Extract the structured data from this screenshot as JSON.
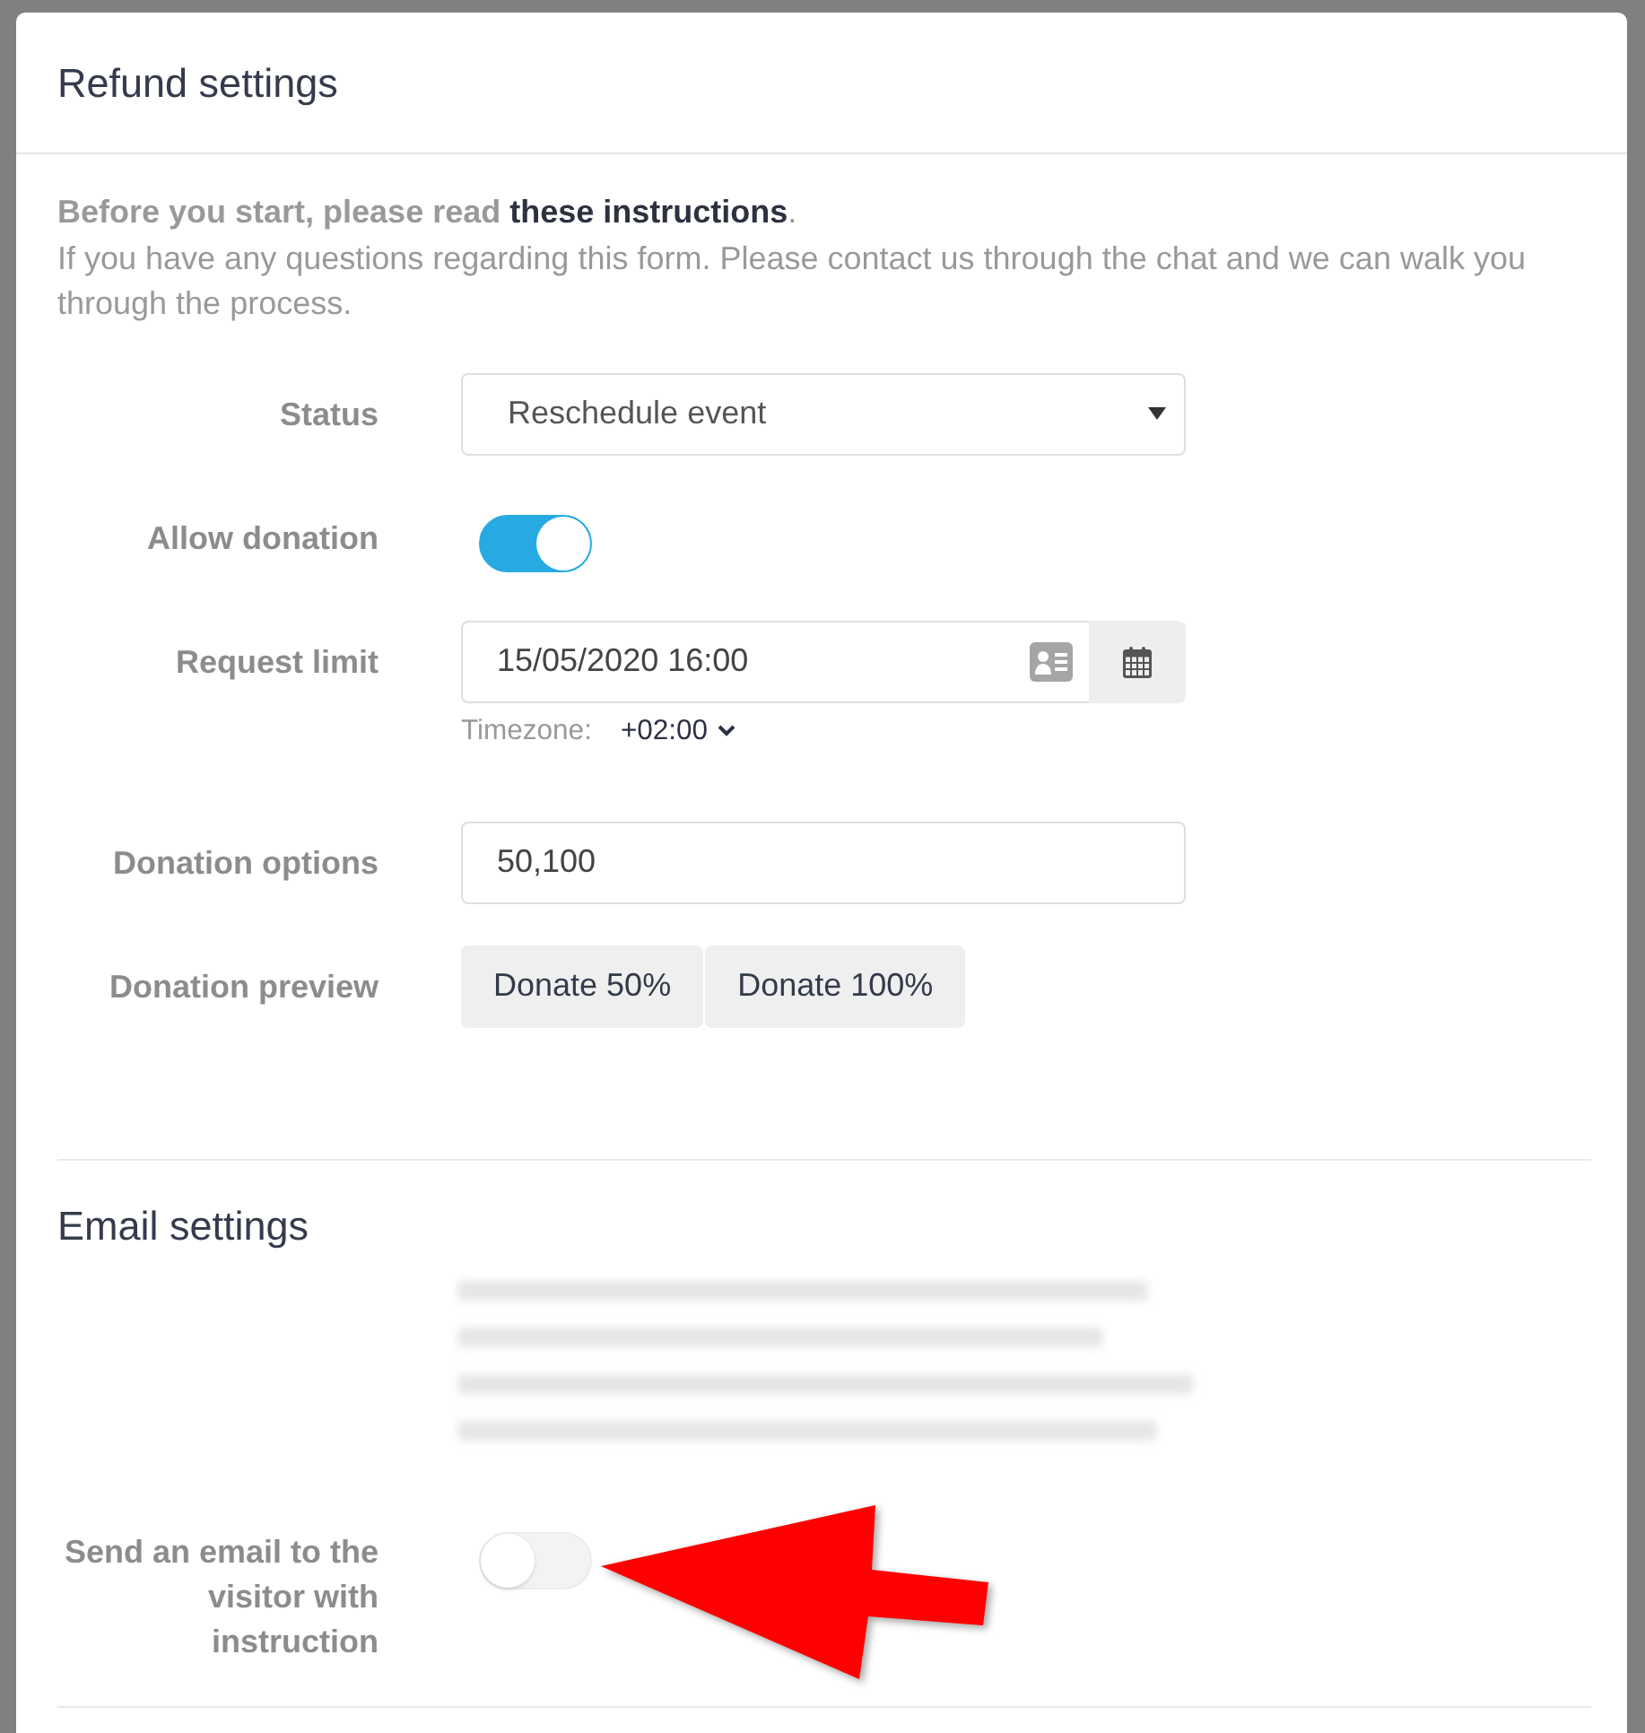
{
  "dialog": {
    "title": "Refund settings"
  },
  "intro": {
    "text": "Before you start, please read",
    "link": "these instructions",
    "end": "."
  },
  "help_text": "If you have any questions regarding this form. Please contact us through the chat and we can walk you through the process.",
  "fields": [
    {
      "kind": "select",
      "label": "Status",
      "value": "Reschedule event"
    },
    {
      "kind": "toggle",
      "label": "Allow donation",
      "on": true
    },
    {
      "kind": "datetime",
      "label": "Request limit",
      "value": "15/05/2020 16:00",
      "timezone_label": "Timezone:",
      "timezone": "+02:00"
    },
    {
      "kind": "text",
      "label": "Donation options",
      "value": "50,100"
    },
    {
      "kind": "buttons",
      "label": "Donation preview",
      "buttons": [
        "Donate 50%",
        "Donate 100%"
      ]
    }
  ],
  "email_settings": {
    "title": "Email settings",
    "fields": [
      {
        "kind": "toggle",
        "label": "Send an email to the visitor with instruction",
        "on": false
      }
    ]
  }
}
